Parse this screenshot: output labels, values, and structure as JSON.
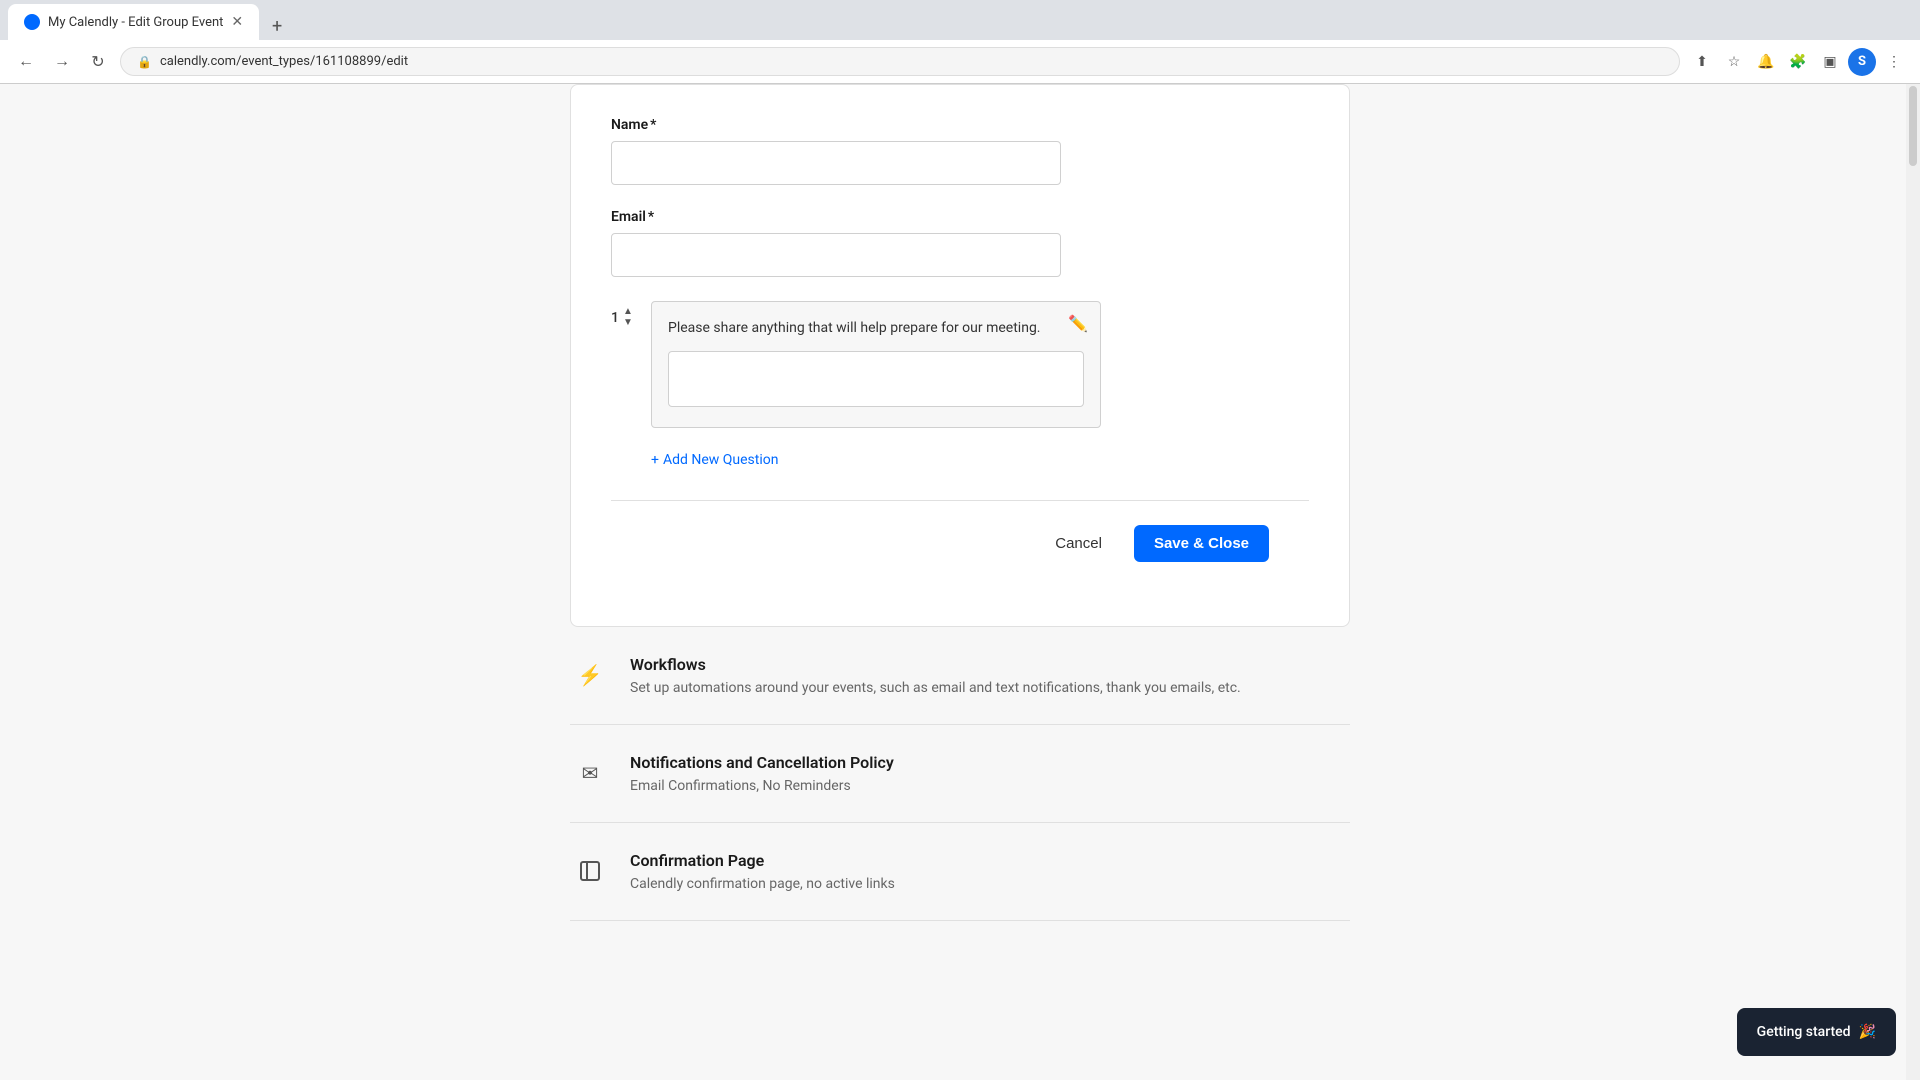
{
  "browser": {
    "tab_title": "My Calendly - Edit Group Event",
    "url": "calendly.com/event_types/161108899/edit",
    "new_tab_label": "+",
    "close_tab_label": "×",
    "profile_letter": "S"
  },
  "form": {
    "name_label": "Name",
    "name_required": "*",
    "email_label": "Email",
    "email_required": "*",
    "question_number": "1",
    "question_text": "Please share anything that will help prepare for our meeting.",
    "add_question_plus": "+",
    "add_question_label": "Add New Question",
    "cancel_label": "Cancel",
    "save_label": "Save & Close"
  },
  "sections": [
    {
      "icon": "⚡",
      "title": "Workflows",
      "desc": "Set up automations around your events, such as email and text notifications, thank you emails, etc."
    },
    {
      "icon": "✉",
      "title": "Notifications and Cancellation Policy",
      "desc": "Email Confirmations, No Reminders"
    },
    {
      "icon": "⬜",
      "title": "Confirmation Page",
      "desc": "Calendly confirmation page, no active links"
    }
  ],
  "toast": {
    "label": "Getting started",
    "emoji": "🎉"
  }
}
